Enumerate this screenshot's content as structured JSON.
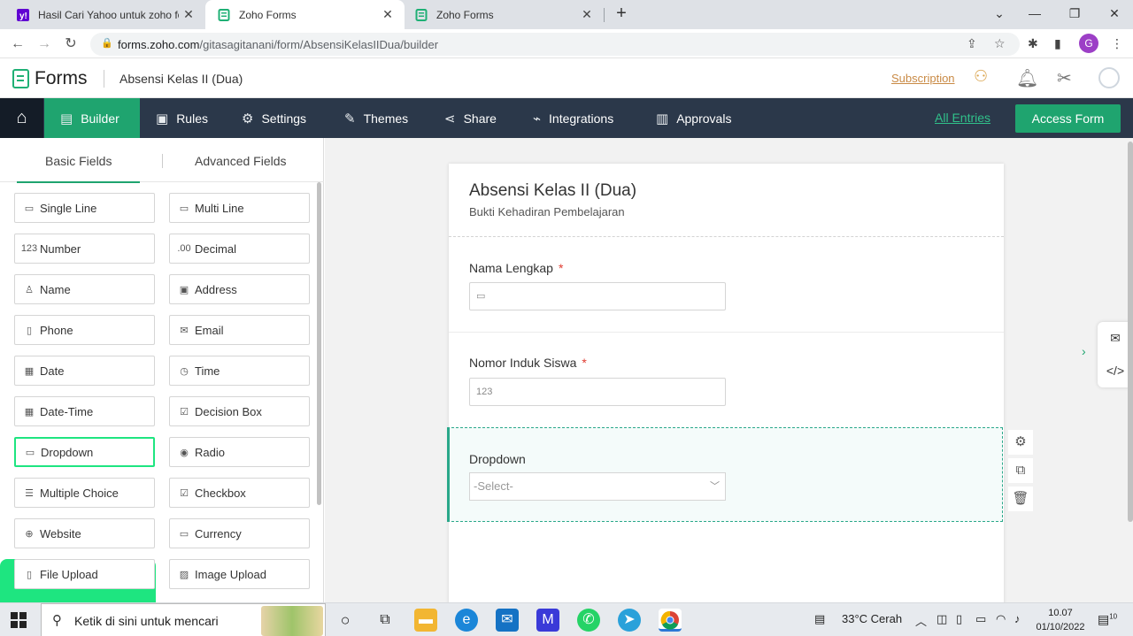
{
  "browser": {
    "tabs": [
      {
        "title": "Hasil Cari Yahoo untuk zoho form",
        "icon": "yahoo-icon",
        "color": "#6001d2"
      },
      {
        "title": "Zoho Forms",
        "icon": "zoho-forms-icon",
        "color": "#1fb075"
      },
      {
        "title": "Zoho Forms",
        "icon": "zoho-forms-icon",
        "color": "#1fb075"
      }
    ],
    "url_host": "forms.zoho.com",
    "url_path": "/gitasagitanani/form/AbsensiKelasIIDua/builder",
    "profile_initial": "G"
  },
  "app": {
    "logo": "Forms",
    "form_name": "Absensi Kelas II (Dua)",
    "subscription": "Subscription"
  },
  "nav": {
    "items": [
      "Builder",
      "Rules",
      "Settings",
      "Themes",
      "Share",
      "Integrations",
      "Approvals"
    ],
    "all_entries": "All Entries",
    "access_form": "Access Form"
  },
  "panel": {
    "tabs": [
      "Basic Fields",
      "Advanced Fields"
    ],
    "fields": [
      "Single Line",
      "Multi Line",
      "Number",
      "Decimal",
      "Name",
      "Address",
      "Phone",
      "Email",
      "Date",
      "Time",
      "Date-Time",
      "Decision Box",
      "Dropdown",
      "Radio",
      "Multiple Choice",
      "Checkbox",
      "Website",
      "Currency",
      "File Upload",
      "Image Upload"
    ],
    "field_icons": [
      ".00",
      "123"
    ]
  },
  "form": {
    "title": "Absensi Kelas II (Dua)",
    "description": "Bukti Kehadiran Pembelajaran",
    "q1_label": "Nama Lengkap",
    "q2_label": "Nomor Induk Siswa",
    "q2_placeholder": "123",
    "q3_label": "Dropdown",
    "q3_placeholder": "-Select-",
    "required_mark": "*"
  },
  "taskbar": {
    "search_placeholder": "Ketik di sini untuk mencari",
    "weather": "33°C  Cerah",
    "time": "10.07",
    "date": "01/10/2022",
    "notif_count": "10"
  }
}
